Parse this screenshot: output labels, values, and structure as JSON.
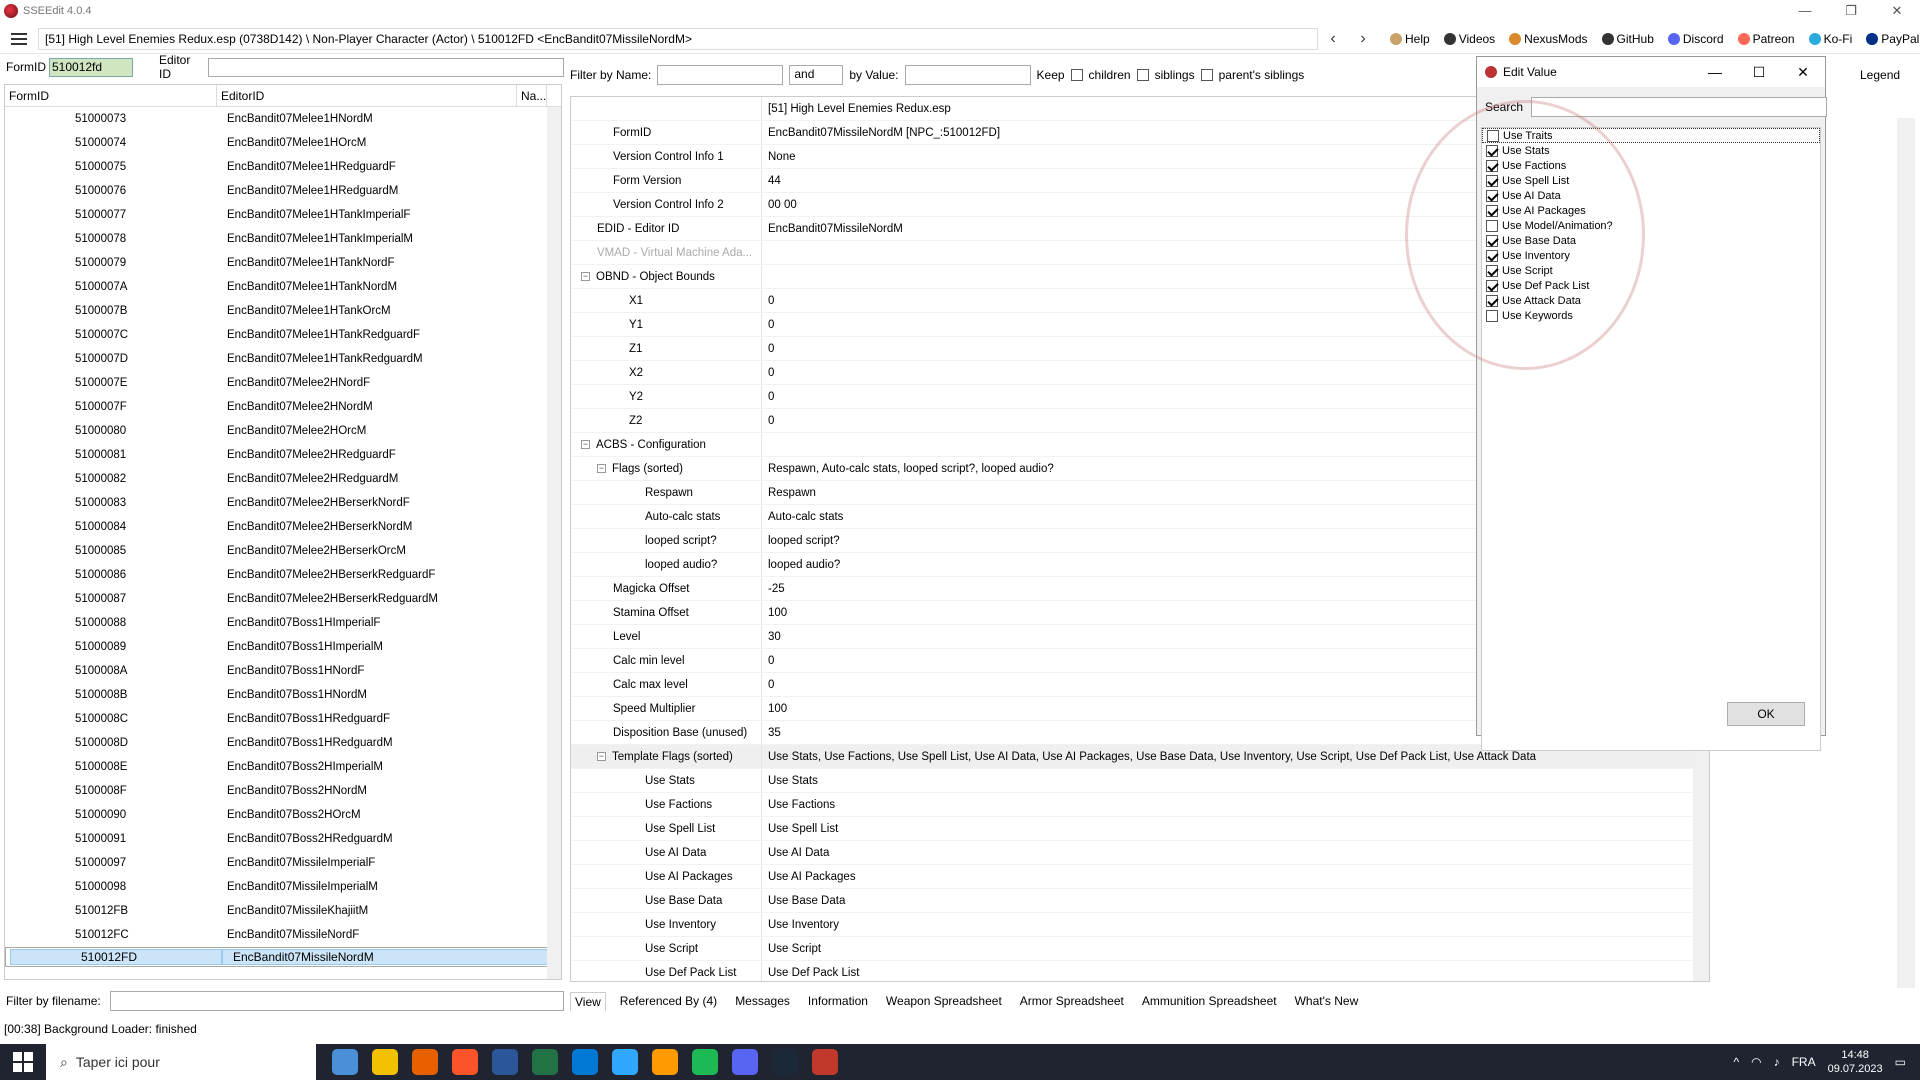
{
  "window": {
    "title": "SSEEdit 4.0.4"
  },
  "path": "[51] High Level Enemies Redux.esp (0738D142) \\ Non-Player Character (Actor) \\ 510012FD <EncBandit07MissileNordM>",
  "top_links": [
    "Help",
    "Videos",
    "NexusMods",
    "GitHub",
    "Discord",
    "Patreon",
    "Ko-Fi",
    "PayPal"
  ],
  "formid_bar": {
    "formid_label": "FormID",
    "formid_value": "510012fd",
    "editorid_label": "Editor ID",
    "editorid_value": ""
  },
  "left_table": {
    "headers": [
      "FormID",
      "EditorID",
      "Na..."
    ],
    "rows": [
      [
        "51000073",
        "EncBandit07Melee1HNordM"
      ],
      [
        "51000074",
        "EncBandit07Melee1HOrcM"
      ],
      [
        "51000075",
        "EncBandit07Melee1HRedguardF"
      ],
      [
        "51000076",
        "EncBandit07Melee1HRedguardM"
      ],
      [
        "51000077",
        "EncBandit07Melee1HTankImperialF"
      ],
      [
        "51000078",
        "EncBandit07Melee1HTankImperialM"
      ],
      [
        "51000079",
        "EncBandit07Melee1HTankNordF"
      ],
      [
        "5100007A",
        "EncBandit07Melee1HTankNordM"
      ],
      [
        "5100007B",
        "EncBandit07Melee1HTankOrcM"
      ],
      [
        "5100007C",
        "EncBandit07Melee1HTankRedguardF"
      ],
      [
        "5100007D",
        "EncBandit07Melee1HTankRedguardM"
      ],
      [
        "5100007E",
        "EncBandit07Melee2HNordF"
      ],
      [
        "5100007F",
        "EncBandit07Melee2HNordM"
      ],
      [
        "51000080",
        "EncBandit07Melee2HOrcM"
      ],
      [
        "51000081",
        "EncBandit07Melee2HRedguardF"
      ],
      [
        "51000082",
        "EncBandit07Melee2HRedguardM"
      ],
      [
        "51000083",
        "EncBandit07Melee2HBerserkNordF"
      ],
      [
        "51000084",
        "EncBandit07Melee2HBerserkNordM"
      ],
      [
        "51000085",
        "EncBandit07Melee2HBerserkOrcM"
      ],
      [
        "51000086",
        "EncBandit07Melee2HBerserkRedguardF"
      ],
      [
        "51000087",
        "EncBandit07Melee2HBerserkRedguardM"
      ],
      [
        "51000088",
        "EncBandit07Boss1HImperialF"
      ],
      [
        "51000089",
        "EncBandit07Boss1HImperialM"
      ],
      [
        "5100008A",
        "EncBandit07Boss1HNordF"
      ],
      [
        "5100008B",
        "EncBandit07Boss1HNordM"
      ],
      [
        "5100008C",
        "EncBandit07Boss1HRedguardF"
      ],
      [
        "5100008D",
        "EncBandit07Boss1HRedguardM"
      ],
      [
        "5100008E",
        "EncBandit07Boss2HImperialM"
      ],
      [
        "5100008F",
        "EncBandit07Boss2HNordM"
      ],
      [
        "51000090",
        "EncBandit07Boss2HOrcM"
      ],
      [
        "51000091",
        "EncBandit07Boss2HRedguardM"
      ],
      [
        "51000097",
        "EncBandit07MissileImperialF"
      ],
      [
        "51000098",
        "EncBandit07MissileImperialM"
      ],
      [
        "510012FB",
        "EncBandit07MissileKhajiitM"
      ],
      [
        "510012FC",
        "EncBandit07MissileNordF"
      ],
      [
        "510012FD",
        "EncBandit07MissileNordM"
      ]
    ]
  },
  "filter": {
    "by_name": "Filter by Name:",
    "op": "and",
    "by_value": "by Value:",
    "keep": "Keep",
    "children": "children",
    "siblings": "siblings",
    "parents_siblings": "parent's siblings"
  },
  "grid": {
    "header": "[51] High Level Enemies Redux.esp",
    "rows": [
      {
        "k": "FormID",
        "v": "EncBandit07MissileNordM [NPC_:510012FD]",
        "i": 2
      },
      {
        "k": "Version Control Info 1",
        "v": "None",
        "i": 2
      },
      {
        "k": "Form Version",
        "v": "44",
        "i": 2
      },
      {
        "k": "Version Control Info 2",
        "v": "00 00",
        "i": 2
      },
      {
        "k": "EDID - Editor ID",
        "v": "EncBandit07MissileNordM",
        "i": 1
      },
      {
        "k": "VMAD - Virtual Machine Ada...",
        "v": "",
        "i": 1,
        "dim": true
      },
      {
        "k": "OBND - Object Bounds",
        "v": "",
        "i": 0,
        "e": true
      },
      {
        "k": "X1",
        "v": "0",
        "i": 3
      },
      {
        "k": "Y1",
        "v": "0",
        "i": 3
      },
      {
        "k": "Z1",
        "v": "0",
        "i": 3
      },
      {
        "k": "X2",
        "v": "0",
        "i": 3
      },
      {
        "k": "Y2",
        "v": "0",
        "i": 3
      },
      {
        "k": "Z2",
        "v": "0",
        "i": 3
      },
      {
        "k": "ACBS - Configuration",
        "v": "",
        "i": 0,
        "e": true
      },
      {
        "k": "Flags (sorted)",
        "v": "Respawn, Auto-calc stats, looped script?, looped audio?",
        "i": 1,
        "e": true
      },
      {
        "k": "Respawn",
        "v": "Respawn",
        "i": 4
      },
      {
        "k": "Auto-calc stats",
        "v": "Auto-calc stats",
        "i": 4
      },
      {
        "k": "looped script?",
        "v": "looped script?",
        "i": 4
      },
      {
        "k": "looped audio?",
        "v": "looped audio?",
        "i": 4
      },
      {
        "k": "Magicka Offset",
        "v": "-25",
        "i": 2
      },
      {
        "k": "Stamina Offset",
        "v": "100",
        "i": 2
      },
      {
        "k": "Level",
        "v": "30",
        "i": 2
      },
      {
        "k": "Calc min level",
        "v": "0",
        "i": 2
      },
      {
        "k": "Calc max level",
        "v": "0",
        "i": 2
      },
      {
        "k": "Speed Multiplier",
        "v": "100",
        "i": 2
      },
      {
        "k": "Disposition Base (unused)",
        "v": "35",
        "i": 2
      },
      {
        "k": "Template Flags (sorted)",
        "v": "Use Stats, Use Factions, Use Spell List, Use AI Data, Use AI Packages, Use Base Data, Use Inventory, Use Script, Use Def Pack List, Use Attack Data",
        "i": 1,
        "e": true,
        "hl": true
      },
      {
        "k": "Use Stats",
        "v": "Use Stats",
        "i": 4
      },
      {
        "k": "Use Factions",
        "v": "Use Factions",
        "i": 4
      },
      {
        "k": "Use Spell List",
        "v": "Use Spell List",
        "i": 4
      },
      {
        "k": "Use AI Data",
        "v": "Use AI Data",
        "i": 4
      },
      {
        "k": "Use AI Packages",
        "v": "Use AI Packages",
        "i": 4
      },
      {
        "k": "Use Base Data",
        "v": "Use Base Data",
        "i": 4
      },
      {
        "k": "Use Inventory",
        "v": "Use Inventory",
        "i": 4
      },
      {
        "k": "Use Script",
        "v": "Use Script",
        "i": 4
      },
      {
        "k": "Use Def Pack List",
        "v": "Use Def Pack List",
        "i": 4
      }
    ]
  },
  "dialog": {
    "title": "Edit Value",
    "search_label": "Search",
    "ok": "OK",
    "items": [
      {
        "l": "Use Traits",
        "c": false
      },
      {
        "l": "Use Stats",
        "c": true
      },
      {
        "l": "Use Factions",
        "c": true
      },
      {
        "l": "Use Spell List",
        "c": true
      },
      {
        "l": "Use AI Data",
        "c": true
      },
      {
        "l": "Use AI Packages",
        "c": true
      },
      {
        "l": "Use Model/Animation?",
        "c": false
      },
      {
        "l": "Use Base Data",
        "c": true
      },
      {
        "l": "Use Inventory",
        "c": true
      },
      {
        "l": "Use Script",
        "c": true
      },
      {
        "l": "Use Def Pack List",
        "c": true
      },
      {
        "l": "Use Attack Data",
        "c": true
      },
      {
        "l": "Use Keywords",
        "c": false
      }
    ]
  },
  "legend": "Legend",
  "bottom_tabs": [
    "View",
    "Referenced By (4)",
    "Messages",
    "Information",
    "Weapon Spreadsheet",
    "Armor Spreadsheet",
    "Ammunition Spreadsheet",
    "What's New"
  ],
  "file_filter_label": "Filter by filename:",
  "status": "[00:38] Background Loader: finished",
  "taskbar": {
    "search": "Taper ici pour",
    "lang": "FRA",
    "time": "14:48",
    "date": "09.07.2023"
  }
}
